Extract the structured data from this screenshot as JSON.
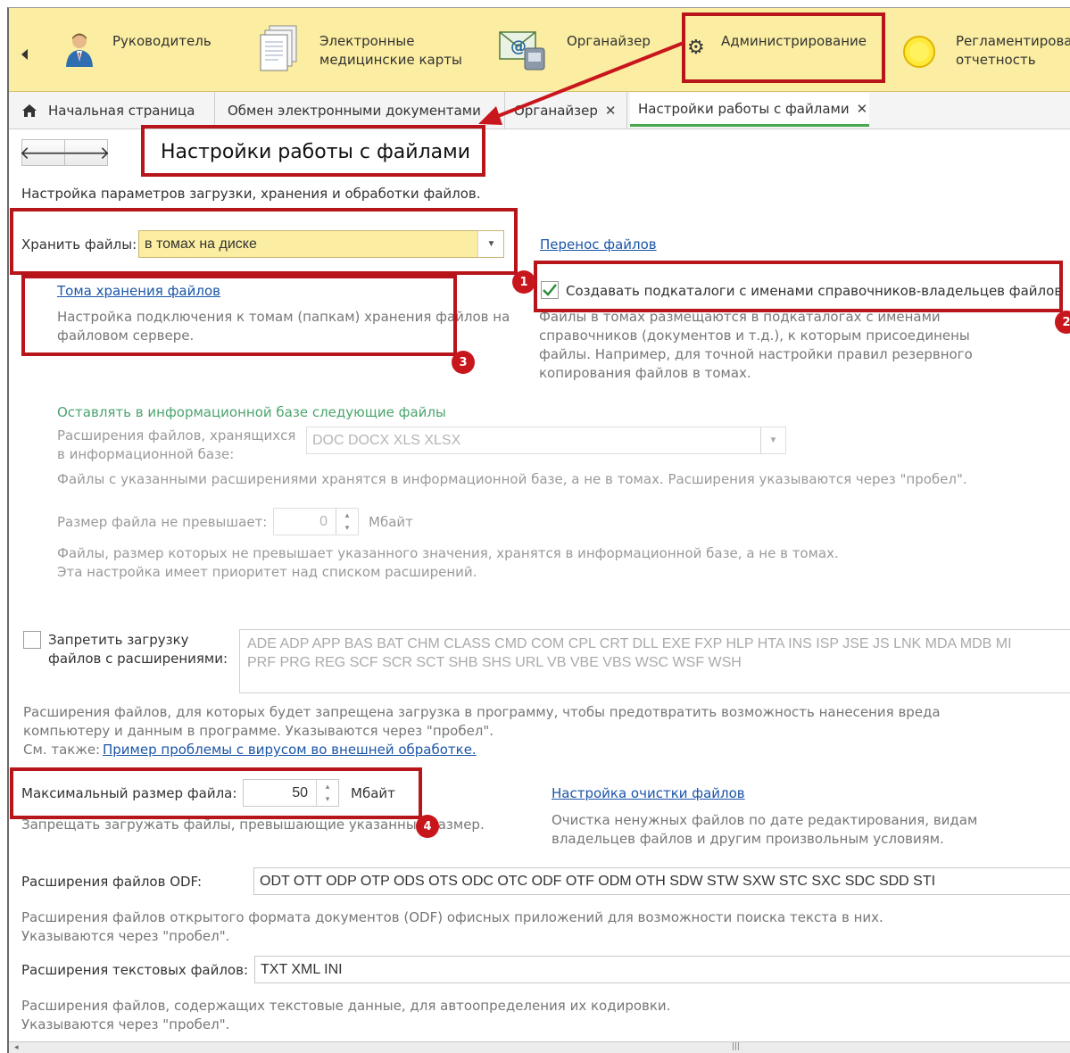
{
  "sections": {
    "items": [
      {
        "label": "Руководитель",
        "icon": "manager-person-icon"
      },
      {
        "label": "Электронные\nмедицинские карты",
        "icon": "documents-stack-icon"
      },
      {
        "label": "Органайзер",
        "icon": "organizer-email-icon"
      },
      {
        "label": "Администрирование",
        "icon": "gear-icon"
      },
      {
        "label": "Регламентирова\nотчетность",
        "icon": "yellow-circle-icon"
      }
    ]
  },
  "tabs": {
    "home": "Начальная страница",
    "items": [
      {
        "label": "Обмен электронными документами"
      },
      {
        "label": "Органайзер"
      },
      {
        "label": "Настройки работы с файлами"
      }
    ]
  },
  "page": {
    "title": "Настройки работы с файлами",
    "description": "Настройка параметров загрузки, хранения и обработки файлов."
  },
  "storage": {
    "label": "Хранить файлы:",
    "value": "в томах на диске",
    "transfer_link": "Перенос файлов",
    "volumes_link": "Тома хранения файлов",
    "volumes_desc": "Настройка подключения к томам (папкам) хранения файлов на\nфайловом сервере.",
    "subdirs_label": "Создавать подкаталоги с именами справочников-владельцев файлов",
    "subdirs_checked": true,
    "subdirs_desc": "Файлы в томах размещаются в подкаталогах с именами\nсправочников (документов и т.д.), к которым присоединены\nфайлы. Например, для точной настройки правил резервного\nкопирования файлов в томах."
  },
  "infobase": {
    "heading": "Оставлять в информационной базе следующие файлы",
    "ext_label": "Расширения файлов, хранящихся\nв информационной базе:",
    "ext_value": "DOC DOCX XLS XLSX",
    "ext_desc": "Файлы с указанными расширениями хранятся в информационной базе, а не в томах. Расширения указываются через \"пробел\".",
    "size_label": "Размер файла не превышает:",
    "size_value": "0",
    "size_unit": "Мбайт",
    "size_desc": "Файлы, размер которых не превышает указанного значения, хранятся в информационной базе, а не в томах.\nЭта настройка имеет приоритет над списком расширений."
  },
  "forbid": {
    "label": "Запретить загрузку\nфайлов с расширениями:",
    "checked": false,
    "extensions": "ADE ADP APP BAS BAT CHM CLASS CMD COM CPL CRT DLL EXE FXP HLP HTA INS ISP JSE JS LNK MDA MDB MI\nPRF PRG REG SCF SCR SCT SHB SHS URL VB VBE VBS WSC WSF WSH",
    "desc": "Расширения файлов, для которых будет запрещена загрузка в программу, чтобы предотвратить возможность нанесения вреда\nкомпьютеру и данным в программе. Указываются через \"пробел\".",
    "see_also": "См. также:",
    "see_also_link": "Пример проблемы с вирусом во внешней  обработке."
  },
  "max_size": {
    "label": "Максимальный размер файла:",
    "value": "50",
    "unit": "Мбайт",
    "desc": "Запрещать загружать файлы, превышающие указанный размер.",
    "cleanup_link": "Настройка очистки файлов",
    "cleanup_desc": "Очистка ненужных файлов по дате редактирования, видам\nвладельцев файлов и другим произвольным условиям."
  },
  "odf": {
    "label": "Расширения файлов ODF:",
    "value": "ODT OTT ODP OTP ODS OTS ODC OTC ODF OTF ODM OTH SDW STW SXW STC SXC SDC SDD STI",
    "desc": "Расширения файлов открытого формата документов (ODF) офисных приложений для возможности поиска текста в них.\nУказываются через \"пробел\"."
  },
  "text_ext": {
    "label": "Расширения текстовых файлов:",
    "value": "TXT XML INI",
    "desc": "Расширения файлов, содержащих текстовые данные, для автоопределения их кодировки.\nУказываются через \"пробел\"."
  },
  "annotations": [
    "1",
    "2",
    "3",
    "4"
  ],
  "colors": {
    "highlight": "#b8151b",
    "badge": "#c8161d",
    "sections_bg": "#fbeda1",
    "link": "#1a55a8",
    "heading_green": "#4ca46e"
  }
}
